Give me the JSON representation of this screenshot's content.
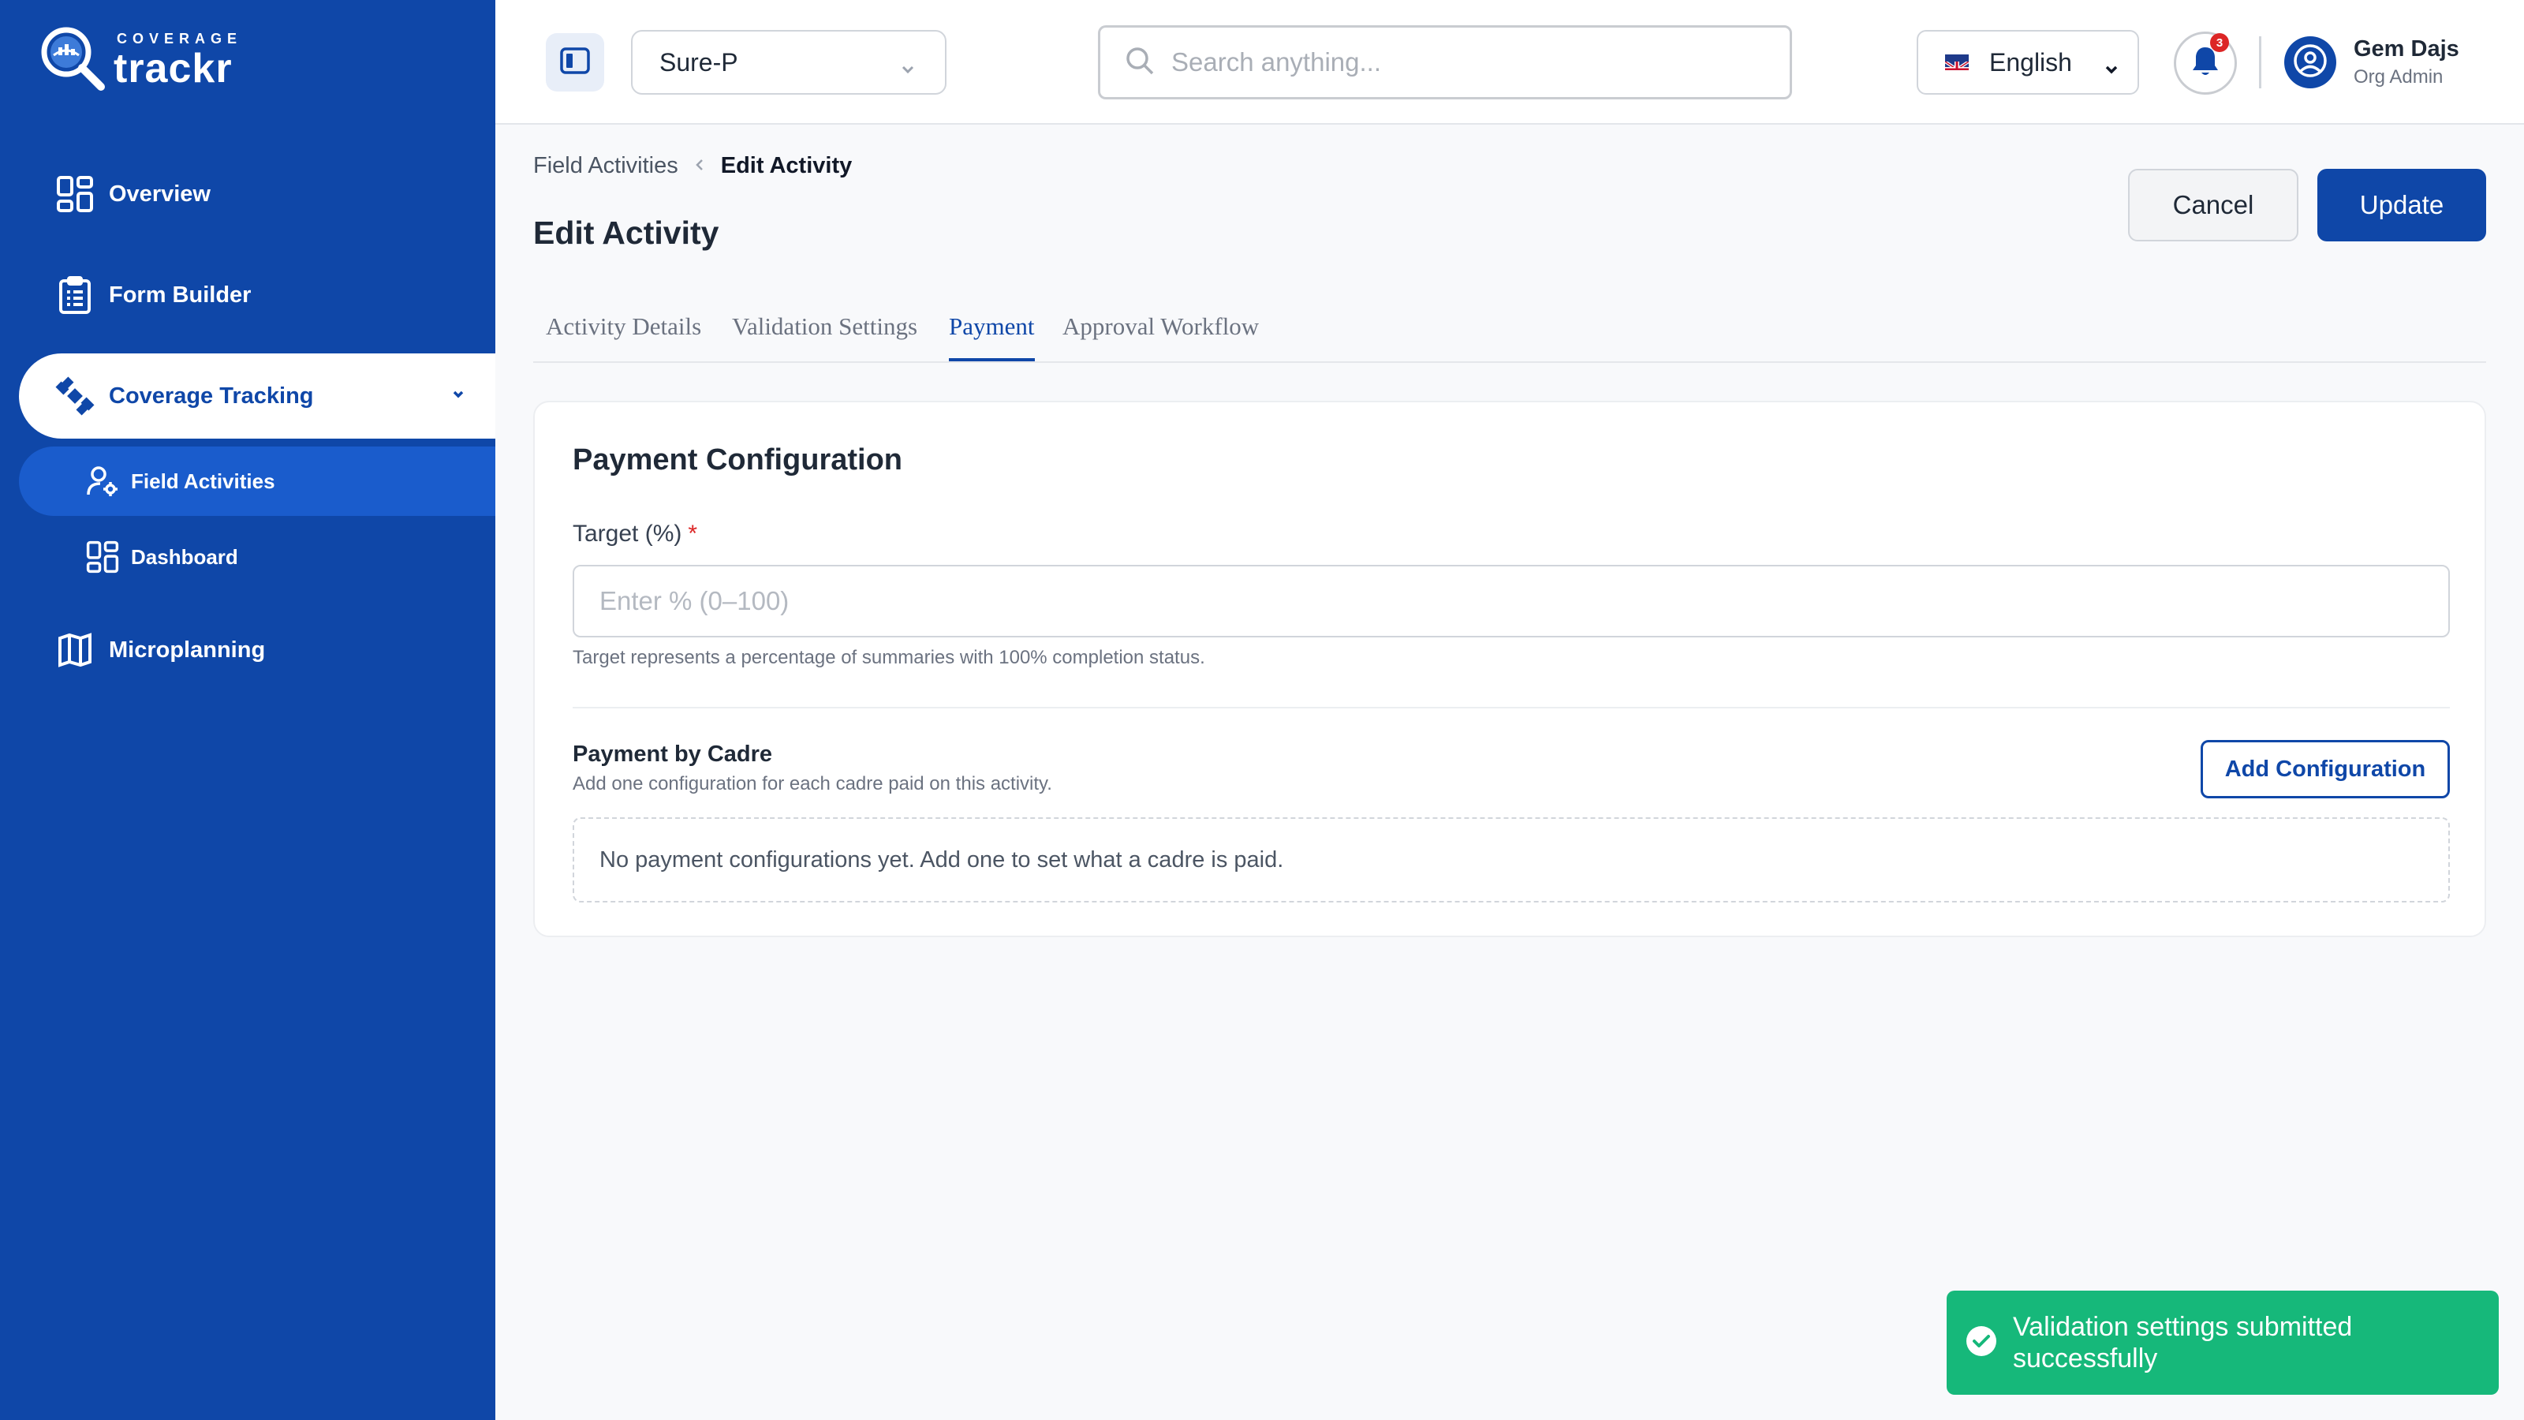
{
  "app": {
    "logo_top": "COVERAGE",
    "logo_main": "trackr"
  },
  "sidebar": {
    "items": [
      {
        "label": "Overview",
        "icon": "grid-icon"
      },
      {
        "label": "Form Builder",
        "icon": "clipboard-icon"
      },
      {
        "label": "Coverage Tracking",
        "icon": "satellite-icon",
        "expanded": true
      },
      {
        "label": "Microplanning",
        "icon": "map-icon"
      }
    ],
    "sub_items": [
      {
        "label": "Field Activities",
        "icon": "user-gear-icon",
        "selected": true
      },
      {
        "label": "Dashboard",
        "icon": "grid-icon"
      }
    ]
  },
  "header": {
    "org": "Sure-P",
    "search_placeholder": "Search anything...",
    "language": "English",
    "notifications_count": "3",
    "user_name": "Gem Dajs",
    "user_role": "Org Admin"
  },
  "page": {
    "breadcrumb_parent": "Field Activities",
    "breadcrumb_current": "Edit Activity",
    "title": "Edit Activity",
    "cancel_label": "Cancel",
    "update_label": "Update",
    "tabs": [
      "Activity Details",
      "Validation Settings",
      "Payment",
      "Approval Workflow"
    ],
    "active_tab": "Payment"
  },
  "payment": {
    "card_title": "Payment Configuration",
    "target_label": "Target (%)",
    "required_mark": "*",
    "target_placeholder": "Enter % (0–100)",
    "target_value": "",
    "target_help": "Target represents a percentage of summaries with 100% completion status.",
    "cadre_title": "Payment by Cadre",
    "cadre_subtitle": "Add one configuration for each cadre paid on this activity.",
    "add_button": "Add Configuration",
    "empty_message": "No payment configurations yet. Add one to set what a cadre is paid."
  },
  "toast": {
    "message": "Validation settings submitted successfully"
  },
  "colors": {
    "brand": "#0f47a8",
    "success": "#16b87a",
    "danger": "#dc2626"
  }
}
